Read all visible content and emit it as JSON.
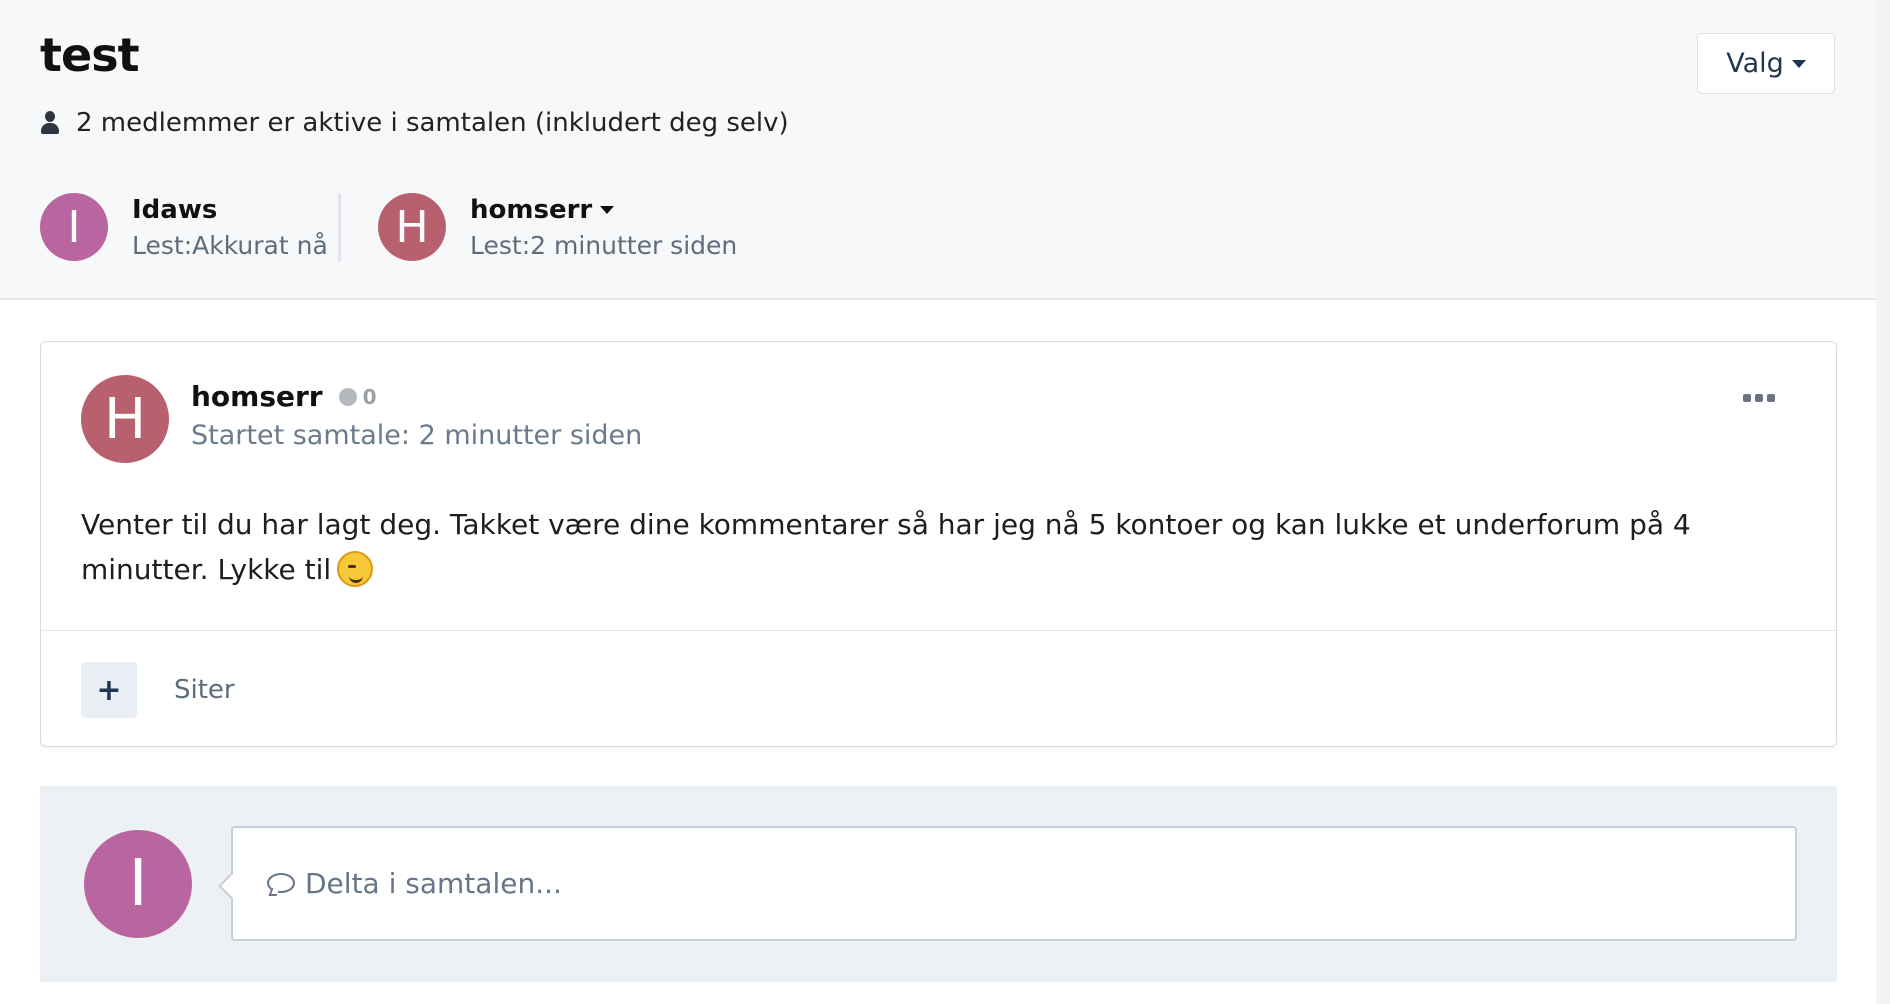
{
  "header": {
    "title": "test",
    "options_label": "Valg",
    "members_text": "2 medlemmer er aktive i samtalen (inkludert deg selv)",
    "participants": [
      {
        "initial": "I",
        "name": "Idaws",
        "read": "Lest:Akkurat nå",
        "avatar_color": "#b965a0"
      },
      {
        "initial": "H",
        "name": "homserr",
        "read": "Lest:2 minutter siden",
        "avatar_color": "#b9606f"
      }
    ]
  },
  "post": {
    "author_initial": "H",
    "author": "homserr",
    "reputation": "0",
    "started": "Startet samtale: 2 minutter siden",
    "body": "Venter til du har lagt deg. Takket være dine kommentarer så har jeg nå 5 kontoer og kan lukke et underforum på 4 minutter. Lykke til",
    "emoji": "wink-emoji",
    "quote_button_symbol": "+",
    "quote_label": "Siter"
  },
  "reply": {
    "avatar_initial": "I",
    "placeholder": "Delta i samtalen..."
  },
  "colors": {
    "accent": "#1f3550",
    "avatar_i": "#b965a0",
    "avatar_h": "#b9606f"
  }
}
